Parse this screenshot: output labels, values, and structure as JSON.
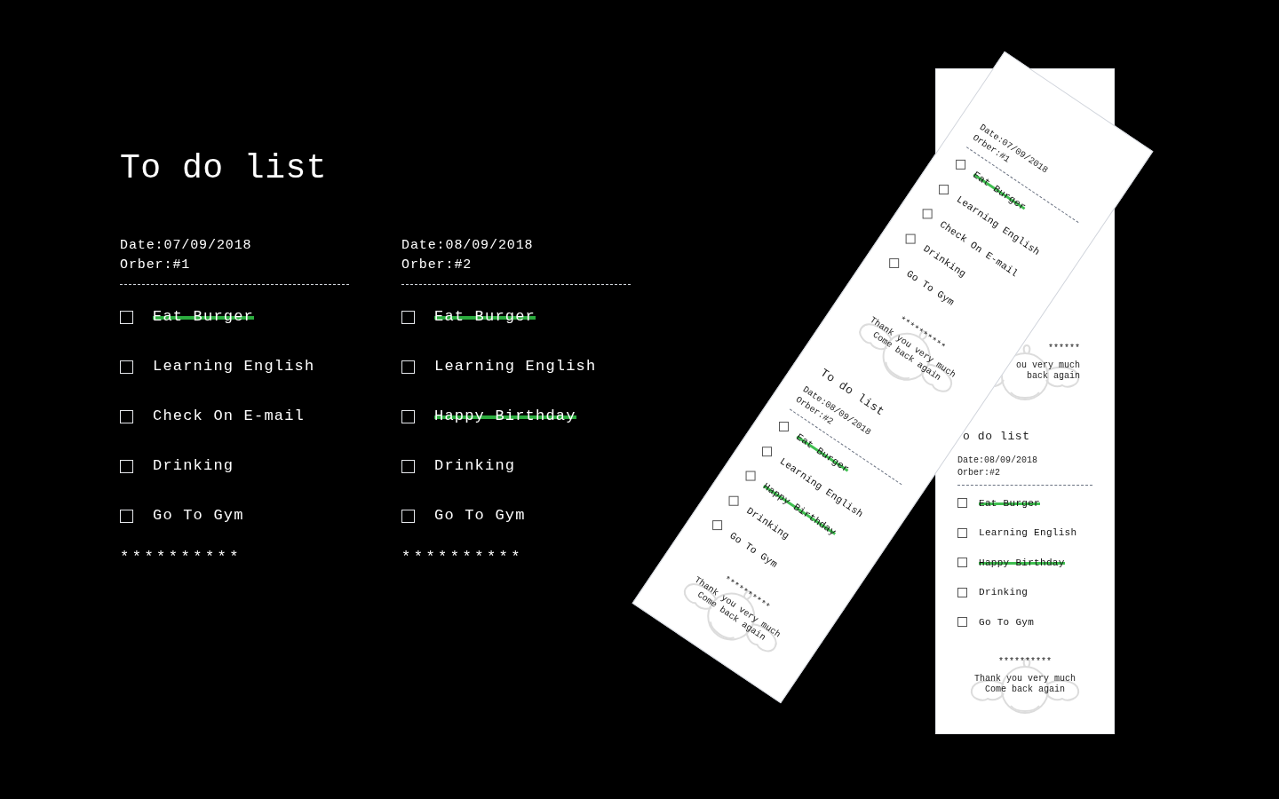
{
  "title": "To do list",
  "lists": [
    {
      "date": "Date:07/09/2018",
      "order": "Orber:#1",
      "stars": "**********",
      "items": [
        {
          "label": "Eat Burger",
          "done": true,
          "checked": false
        },
        {
          "label": "Learning English",
          "done": false,
          "checked": false
        },
        {
          "label": "Check On E-mail",
          "done": false,
          "checked": false
        },
        {
          "label": "Drinking",
          "done": false,
          "checked": false
        },
        {
          "label": "Go To Gym",
          "done": false,
          "checked": false
        }
      ]
    },
    {
      "date": "Date:08/09/2018",
      "order": "Orber:#2",
      "stars": "**********",
      "items": [
        {
          "label": "Eat Burger",
          "done": true,
          "checked": false
        },
        {
          "label": "Learning English",
          "done": false,
          "checked": false
        },
        {
          "label": "Happy Birthday",
          "done": true,
          "checked": false
        },
        {
          "label": "Drinking",
          "done": false,
          "checked": false
        },
        {
          "label": "Go To Gym",
          "done": false,
          "checked": false
        }
      ]
    }
  ],
  "receipts": [
    {
      "kind": "back",
      "sections": [
        {
          "cut_left": true,
          "stars": "******",
          "thanks": [
            "ou very much",
            "back again"
          ]
        },
        {
          "cut_left": false,
          "title": "o do list",
          "date": "Date:08/09/2018",
          "order": "Orber:#2",
          "items": [
            {
              "label": "Eat Burger",
              "done": true,
              "checked": false
            },
            {
              "label": "Learning English",
              "done": false,
              "checked": false
            },
            {
              "label": "Happy Birthday",
              "done": true,
              "checked": false
            },
            {
              "label": "Drinking",
              "done": false,
              "checked": false
            },
            {
              "label": "Go To Gym",
              "done": false,
              "checked": false
            }
          ],
          "stars": "**********",
          "thanks": [
            "Thank you very much",
            "Come back again"
          ]
        }
      ]
    },
    {
      "kind": "front",
      "sections": [
        {
          "cut_left": false,
          "date": "Date:07/09/2018",
          "order": "Orber:#1",
          "items": [
            {
              "label": "Eat Burger",
              "done": true,
              "checked": false
            },
            {
              "label": "Learning English",
              "done": false,
              "checked": false
            },
            {
              "label": "Check On E-mail",
              "done": false,
              "checked": false
            },
            {
              "label": "Drinking",
              "done": false,
              "checked": false
            },
            {
              "label": "Go To Gym",
              "done": false,
              "checked": false
            }
          ],
          "stars": "**********",
          "thanks": [
            "Thank you very much",
            "Come back again"
          ]
        },
        {
          "cut_left": false,
          "title": "To do list",
          "date": "Date:08/09/2018",
          "order": "Orber:#2",
          "items": [
            {
              "label": "Eat Burger",
              "done": true,
              "checked": false
            },
            {
              "label": "Learning English",
              "done": false,
              "checked": false
            },
            {
              "label": "Happy Birthday",
              "done": true,
              "checked": false
            },
            {
              "label": "Drinking",
              "done": false,
              "checked": false
            },
            {
              "label": "Go To Gym",
              "done": false,
              "checked": false
            }
          ],
          "stars": "**********",
          "thanks": [
            "Thank you very much",
            "Come back again"
          ]
        }
      ]
    }
  ]
}
